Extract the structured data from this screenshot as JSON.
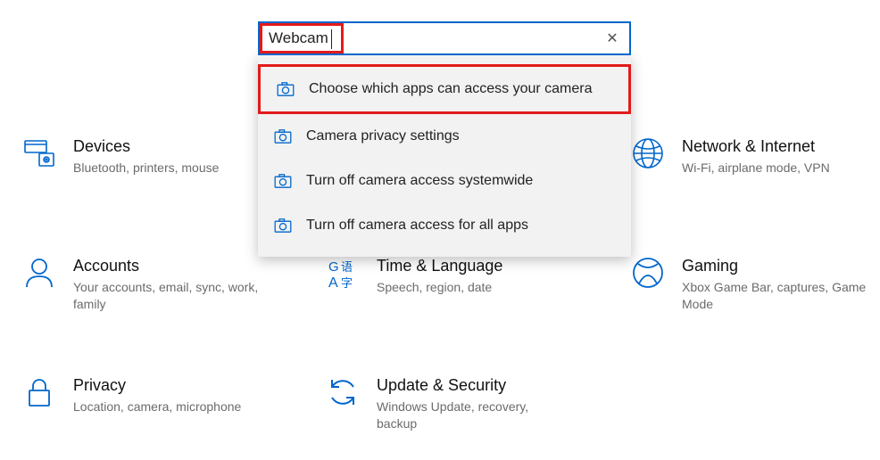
{
  "search": {
    "value": "Webcam",
    "clear_glyph": "✕"
  },
  "suggestions": [
    {
      "label": "Choose which apps can access your camera",
      "highlight": true
    },
    {
      "label": "Camera privacy settings",
      "highlight": false
    },
    {
      "label": "Turn off camera access systemwide",
      "highlight": false
    },
    {
      "label": "Turn off camera access for all apps",
      "highlight": false
    }
  ],
  "tiles": {
    "devices": {
      "title": "Devices",
      "sub": "Bluetooth, printers, mouse"
    },
    "network": {
      "title": "Network & Internet",
      "sub": "Wi-Fi, airplane mode, VPN"
    },
    "accounts": {
      "title": "Accounts",
      "sub": "Your accounts, email, sync, work, family"
    },
    "time": {
      "title": "Time & Language",
      "sub": "Speech, region, date"
    },
    "gaming": {
      "title": "Gaming",
      "sub": "Xbox Game Bar, captures, Game Mode"
    },
    "privacy": {
      "title": "Privacy",
      "sub": "Location, camera, microphone"
    },
    "update": {
      "title": "Update & Security",
      "sub": "Windows Update, recovery, backup"
    }
  },
  "colors": {
    "accent": "#0066cc",
    "highlight": "#e21b1b"
  }
}
